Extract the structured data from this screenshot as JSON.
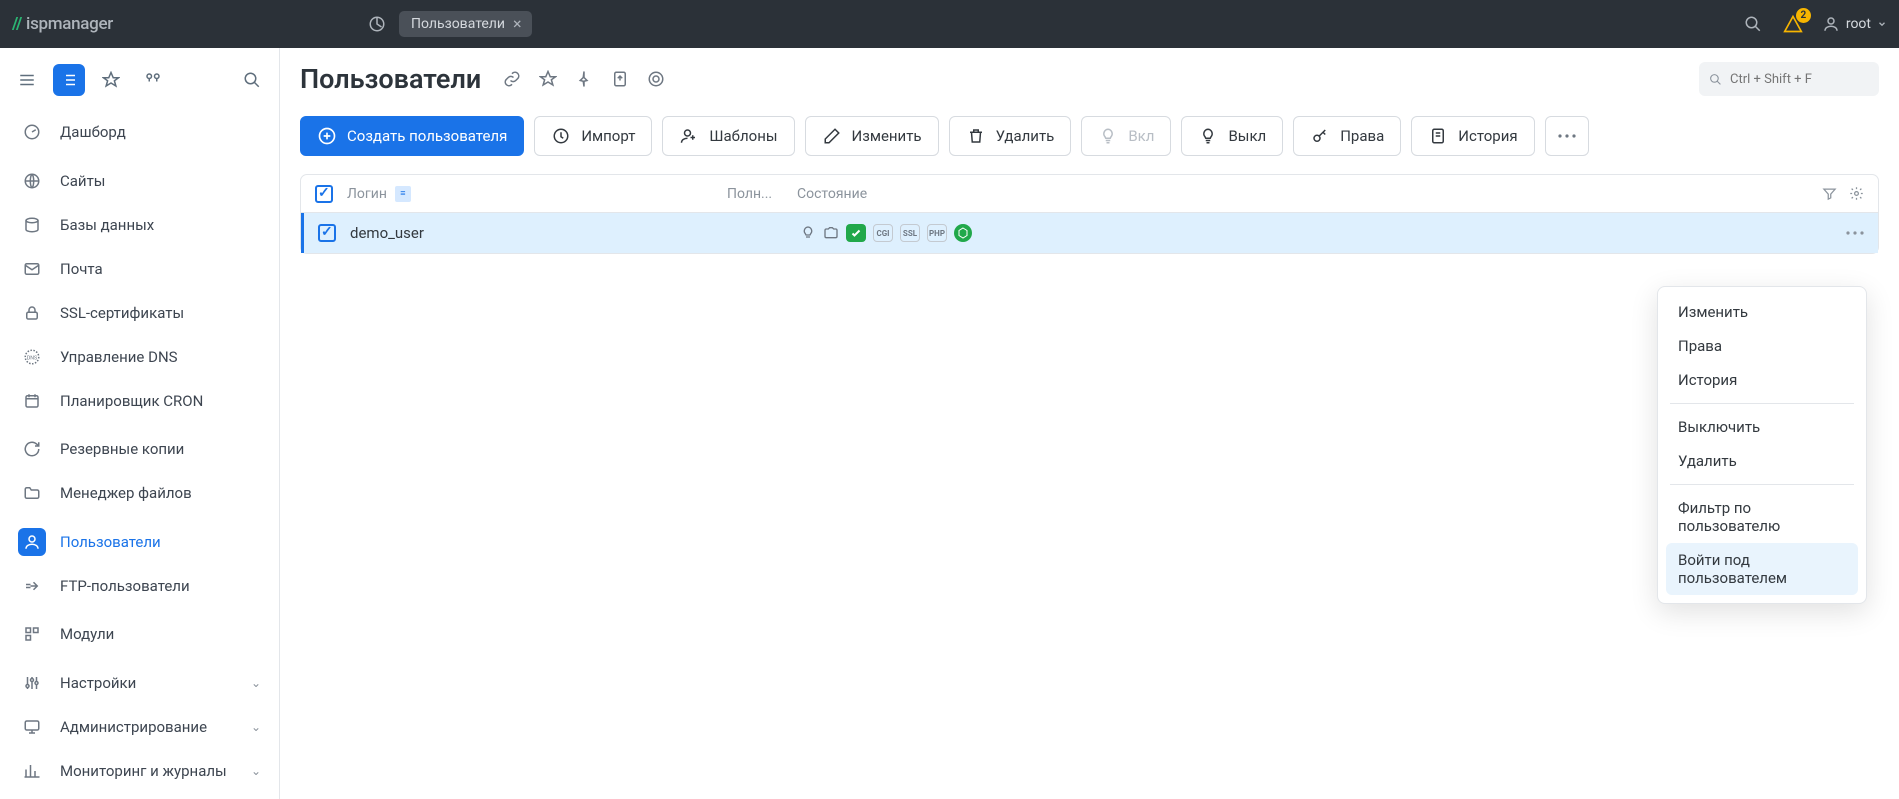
{
  "topbar": {
    "logo_text": "ispmanager",
    "tab_label": "Пользователи",
    "notif_count": "2",
    "username": "root"
  },
  "sidebar": {
    "items": [
      {
        "label": "Дашборд",
        "icon": "gauge"
      },
      {
        "label": "Сайты",
        "icon": "globe"
      },
      {
        "label": "Базы данных",
        "icon": "db"
      },
      {
        "label": "Почта",
        "icon": "mail"
      },
      {
        "label": "SSL-сертификаты",
        "icon": "lock"
      },
      {
        "label": "Управление DNS",
        "icon": "dns"
      },
      {
        "label": "Планировщик CRON",
        "icon": "calendar"
      },
      {
        "label": "Резервные копии",
        "icon": "refresh"
      },
      {
        "label": "Менеджер файлов",
        "icon": "folder"
      },
      {
        "label": "Пользователи",
        "icon": "user",
        "active": true
      },
      {
        "label": "FTP-пользователи",
        "icon": "ftp"
      },
      {
        "label": "Модули",
        "icon": "modules"
      },
      {
        "label": "Настройки",
        "icon": "sliders",
        "chevron": true
      },
      {
        "label": "Администрирование",
        "icon": "monitor",
        "chevron": true
      },
      {
        "label": "Мониторинг и журналы",
        "icon": "chart",
        "chevron": true
      }
    ]
  },
  "page": {
    "title": "Пользователи",
    "search_placeholder": "Ctrl + Shift + F"
  },
  "toolbar": {
    "create": "Создать пользователя",
    "import": "Импорт",
    "templates": "Шаблоны",
    "edit": "Изменить",
    "delete": "Удалить",
    "enable": "Вкл",
    "disable": "Выкл",
    "permissions": "Права",
    "history": "История"
  },
  "table": {
    "headers": {
      "login": "Логин",
      "fullname": "Полн...",
      "state": "Состояние"
    },
    "rows": [
      {
        "login": "demo_user"
      }
    ]
  },
  "context_menu": {
    "edit": "Изменить",
    "permissions": "Права",
    "history": "История",
    "disable": "Выключить",
    "delete": "Удалить",
    "filter": "Фильтр по пользователю",
    "login_as": "Войти под пользователем"
  }
}
